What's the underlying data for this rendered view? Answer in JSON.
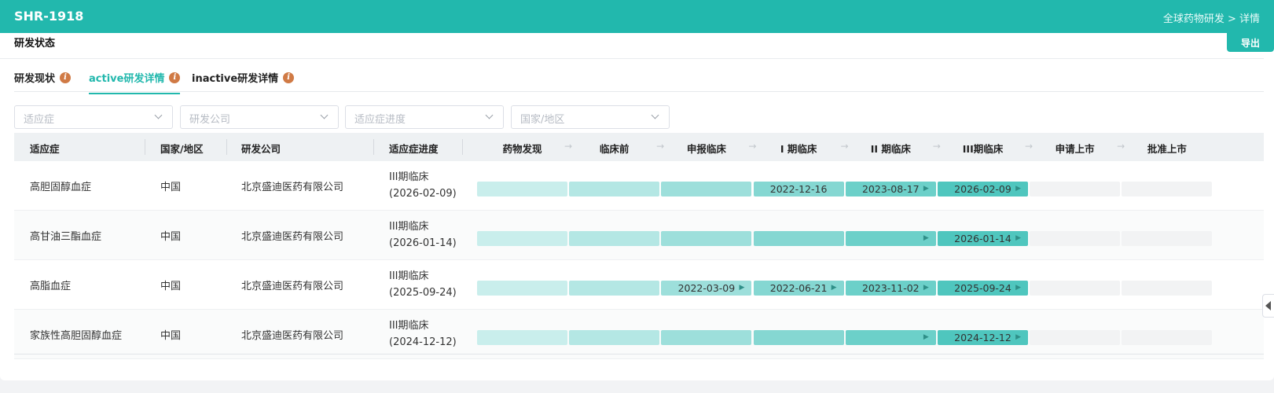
{
  "header": {
    "title": "SHR-1918",
    "breadcrumb": "全球药物研发 > 详情"
  },
  "section": {
    "title": "研发状态",
    "export_label": "导出"
  },
  "tabs": [
    {
      "label": "研发现状",
      "active": false,
      "icon": "info-icon"
    },
    {
      "label": "active研发详情",
      "active": true,
      "icon": "info-icon"
    },
    {
      "label": "inactive研发详情",
      "active": false,
      "icon": "info-icon"
    }
  ],
  "filters": [
    {
      "placeholder": "适应症"
    },
    {
      "placeholder": "研发公司"
    },
    {
      "placeholder": "适应症进度"
    },
    {
      "placeholder": "国家/地区"
    }
  ],
  "table": {
    "columns": [
      "适应症",
      "国家/地区",
      "研发公司",
      "适应症进度"
    ],
    "stages": [
      "药物发现",
      "临床前",
      "申报临床",
      "I 期临床",
      "II 期临床",
      "III期临床",
      "申请上市",
      "批准上市"
    ],
    "rows": [
      {
        "indication": "高胆固醇血症",
        "country": "中国",
        "company": "北京盛迪医药有限公司",
        "progress": "III期临床",
        "progress_date": "(2026-02-09)",
        "stage_dates": [
          "",
          "",
          "",
          "2022-12-16",
          "2023-08-17",
          "2026-02-09",
          "",
          ""
        ],
        "filled_through": 5
      },
      {
        "indication": "高甘油三酯血症",
        "country": "中国",
        "company": "北京盛迪医药有限公司",
        "progress": "III期临床",
        "progress_date": "(2026-01-14)",
        "stage_dates": [
          "",
          "",
          "",
          "",
          "",
          "2026-01-14",
          "",
          ""
        ],
        "filled_through": 5
      },
      {
        "indication": "高脂血症",
        "country": "中国",
        "company": "北京盛迪医药有限公司",
        "progress": "III期临床",
        "progress_date": "(2025-09-24)",
        "stage_dates": [
          "",
          "",
          "2022-03-09",
          "2022-06-21",
          "2023-11-02",
          "2025-09-24",
          "",
          ""
        ],
        "filled_through": 5
      },
      {
        "indication": "家族性高胆固醇血症",
        "country": "中国",
        "company": "北京盛迪医药有限公司",
        "progress": "III期临床",
        "progress_date": "(2024-12-12)",
        "stage_dates": [
          "",
          "",
          "",
          "",
          "",
          "2024-12-12",
          "",
          ""
        ],
        "filled_through": 5
      }
    ]
  },
  "colors": {
    "brand": "#22b8ad",
    "stage_fill": [
      "#c9eeec",
      "#b4e7e4",
      "#9ddfdb",
      "#85d7d2",
      "#6cd0c9",
      "#4fc6be"
    ],
    "stage_empty": "#f2f3f4",
    "info_icon": "#d07a45"
  }
}
